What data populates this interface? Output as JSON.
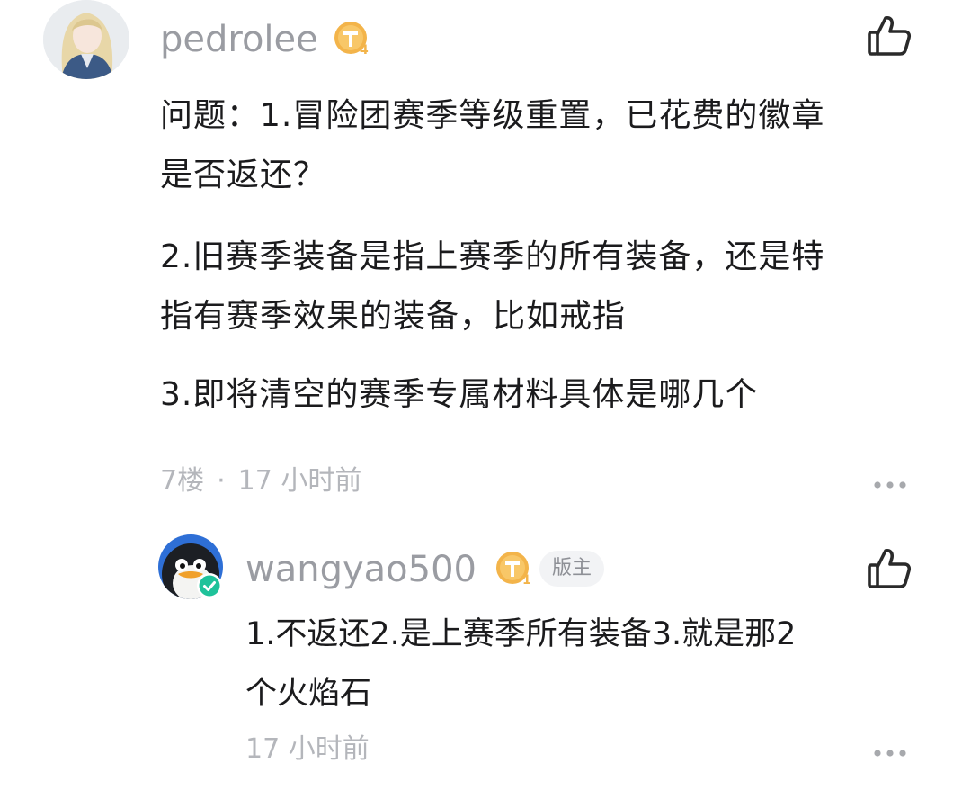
{
  "comment": {
    "username": "pedrolee",
    "level_badge": "T4",
    "lines": [
      "问题：1.冒险团赛季等级重置，已花费的徽章",
      "是否返还？",
      "2.旧赛季装备是指上赛季的所有装备，还是特",
      "指有赛季效果的装备，比如戒指",
      "3.即将清空的赛季专属材料具体是哪几个"
    ],
    "floor": "7楼",
    "separator": "·",
    "time": "17 小时前",
    "like_icon": "thumbs-up-icon",
    "more_icon": "more-dots-icon"
  },
  "reply": {
    "username": "wangyao500",
    "level_badge": "T1",
    "role_tag": "版主",
    "verified_icon": "verified-check-icon",
    "lines": [
      "1.不返还2.是上赛季所有装备3.就是那2",
      "个火焰石"
    ],
    "time": "17 小时前",
    "like_icon": "thumbs-up-icon",
    "more_icon": "more-dots-icon"
  },
  "colors": {
    "username": "#9a9ca2",
    "meta": "#b4b6bb",
    "badge_gold": "#f3b44a",
    "verified": "#1fc29a"
  }
}
